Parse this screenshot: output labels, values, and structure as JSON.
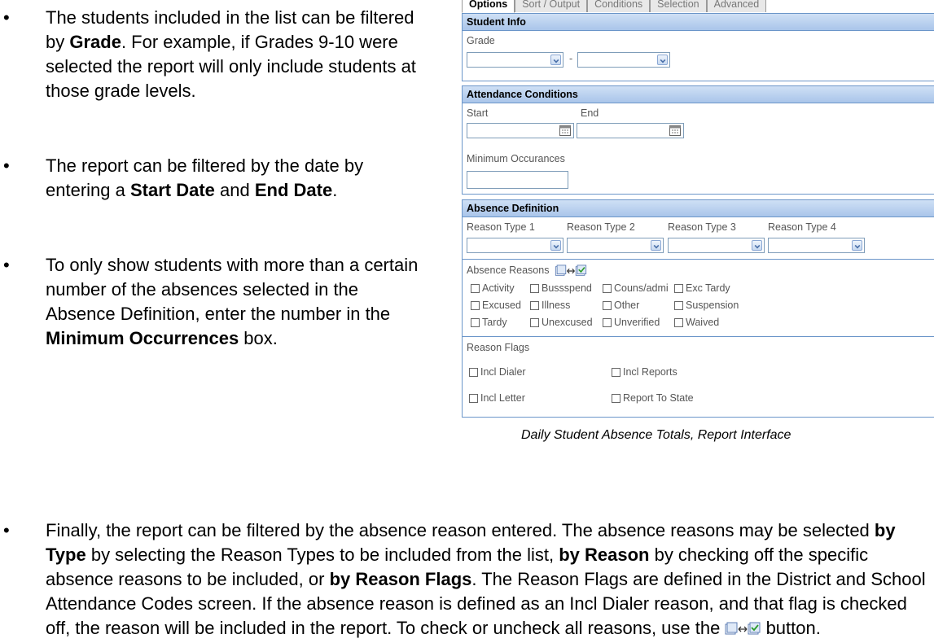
{
  "bullets": [
    {
      "segments": [
        "The students included in the list can be filtered by ",
        "Grade",
        ". For example, if Grades 9-10 were selected the report will only include students at those grade levels."
      ]
    },
    {
      "segments": [
        "The report can be filtered by the date by entering a ",
        "Start Date",
        " and ",
        "End Date",
        "."
      ]
    },
    {
      "segments": [
        "To only show students with more than a certain number of the absences selected in the Absence Definition, enter the number in the ",
        "Minimum Occurrences",
        " box."
      ]
    }
  ],
  "bottom": {
    "segments": [
      "Finally, the report can be filtered by the absence reason entered. The absence reasons may be selected ",
      "by Type",
      " by selecting the Reason Types to be included from the list, ",
      "by Reason",
      " by checking off the specific absence reasons to be included, or ",
      "by Reason Flags",
      ". The Reason Flags are defined in the District and School Attendance Codes screen. If the absence reason is defined as an Incl Dialer reason, and that flag is checked off, the reason will be included in the report. To check or uncheck all reasons, use the ",
      " button."
    ]
  },
  "panel": {
    "tabs": [
      "Options",
      "Sort / Output",
      "Conditions",
      "Selection",
      "Advanced"
    ],
    "student_info": {
      "title": "Student Info",
      "grade_label": "Grade",
      "range_sep": "-"
    },
    "attendance": {
      "title": "Attendance Conditions",
      "start_label": "Start",
      "end_label": "End",
      "min_label": "Minimum Occurances"
    },
    "absence": {
      "title": "Absence Definition",
      "reason_types": [
        "Reason Type 1",
        "Reason Type 2",
        "Reason Type 3",
        "Reason Type 4"
      ],
      "reasons_label": "Absence Reasons",
      "reasons": [
        [
          "Activity",
          "Bussspend",
          "Couns/admi",
          "Exc Tardy"
        ],
        [
          "Excused",
          "Illness",
          "Other",
          "Suspension"
        ],
        [
          "Tardy",
          "Unexcused",
          "Unverified",
          "Waived"
        ]
      ],
      "flags_label": "Reason Flags",
      "flags": [
        [
          "Incl Dialer",
          "Incl Reports"
        ],
        [
          "Incl Letter",
          "Report To State"
        ]
      ]
    }
  },
  "caption": "Daily Student Absence Totals, Report Interface",
  "colors": {
    "header_blue": "#a9c5ea",
    "border_blue": "#6b96c9"
  }
}
